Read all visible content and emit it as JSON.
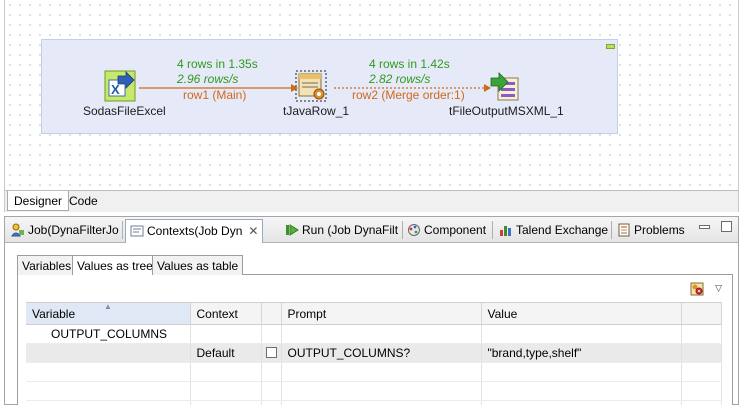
{
  "designer": {
    "components": [
      {
        "name": "SodasFileExcel",
        "icon": "excel-input-icon"
      },
      {
        "name": "tJavaRow_1",
        "icon": "java-row-icon"
      },
      {
        "name": "tFileOutputMSXML_1",
        "icon": "xml-output-icon"
      }
    ],
    "links": [
      {
        "rows": "4 rows in 1.35s",
        "rate": "2.96 rows/s",
        "label": "row1 (Main)"
      },
      {
        "rows": "4 rows in 1.42s",
        "rate": "2.82 rows/s",
        "label": "row2 (Merge order:1)"
      }
    ],
    "editor_tabs": [
      "Designer",
      "Code"
    ]
  },
  "views": {
    "tabs": [
      {
        "label": "Job(DynaFilterJo",
        "icon": "job-icon"
      },
      {
        "label": "Contexts(Job Dyn",
        "icon": "contexts-icon",
        "active": true
      },
      {
        "label": "Run (Job DynaFilt",
        "icon": "run-icon"
      },
      {
        "label": "Component",
        "icon": "component-icon"
      },
      {
        "label": "Talend Exchange",
        "icon": "exchange-icon"
      },
      {
        "label": "Problems",
        "icon": "problems-icon"
      }
    ],
    "context_tabs": [
      "Variables",
      "Values as tree",
      "Values as table"
    ],
    "table": {
      "headers": [
        "Variable",
        "Context",
        "",
        "Prompt",
        "Value"
      ],
      "rows": [
        {
          "variable": "OUTPUT_COLUMNS",
          "context": "",
          "prompt": "",
          "value": ""
        },
        {
          "variable": "",
          "context": "Default",
          "prompt": "OUTPUT_COLUMNS?",
          "value": "\"brand,type,shelf\""
        }
      ]
    }
  },
  "colors": {
    "stats_green": "#2f9a1c",
    "link_orange": "#cf6a18",
    "subjob_bg": "#e6e9f8"
  }
}
